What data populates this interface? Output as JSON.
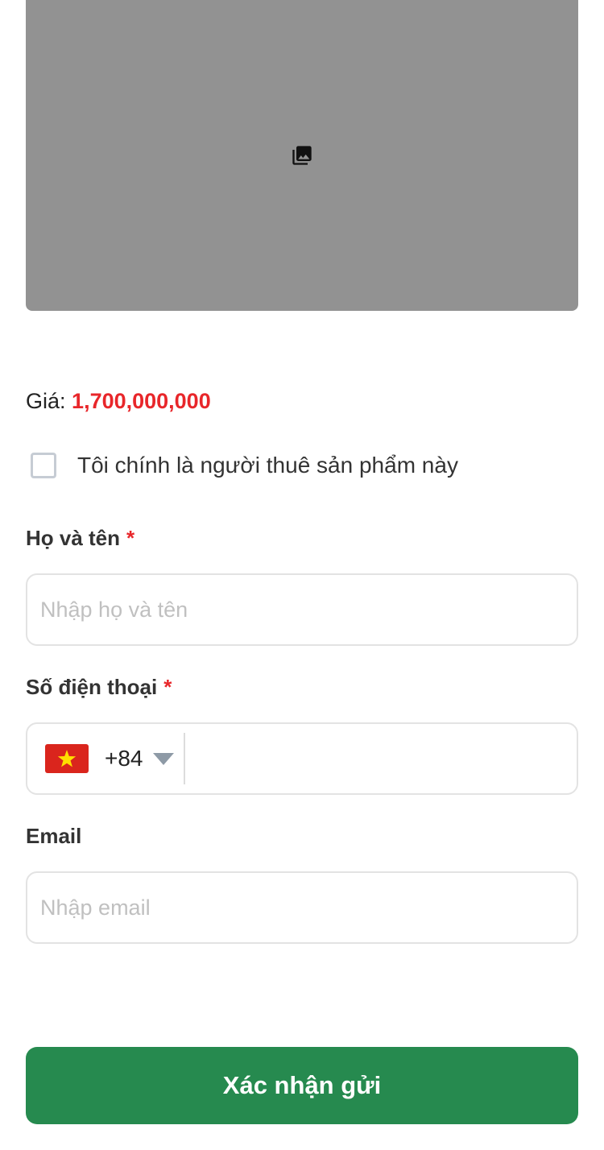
{
  "product_image": {
    "icon": "photo-library-icon"
  },
  "price": {
    "label": "Giá:",
    "value": "1,700,000,000",
    "value_color": "#e8262a"
  },
  "self_renter_checkbox": {
    "label": "Tôi chính là người thuê sản phẩm này",
    "checked": false
  },
  "form": {
    "full_name": {
      "label": "Họ và tên",
      "required_mark": "*",
      "placeholder": "Nhập họ và tên",
      "value": ""
    },
    "phone": {
      "label": "Số điện thoại",
      "required_mark": "*",
      "country_flag_icon": "vietnam-flag-icon",
      "dial_code": "+84",
      "value": ""
    },
    "email": {
      "label": "Email",
      "placeholder": "Nhập email",
      "value": ""
    }
  },
  "submit": {
    "label": "Xác nhận gửi",
    "color": "#268a4f"
  }
}
